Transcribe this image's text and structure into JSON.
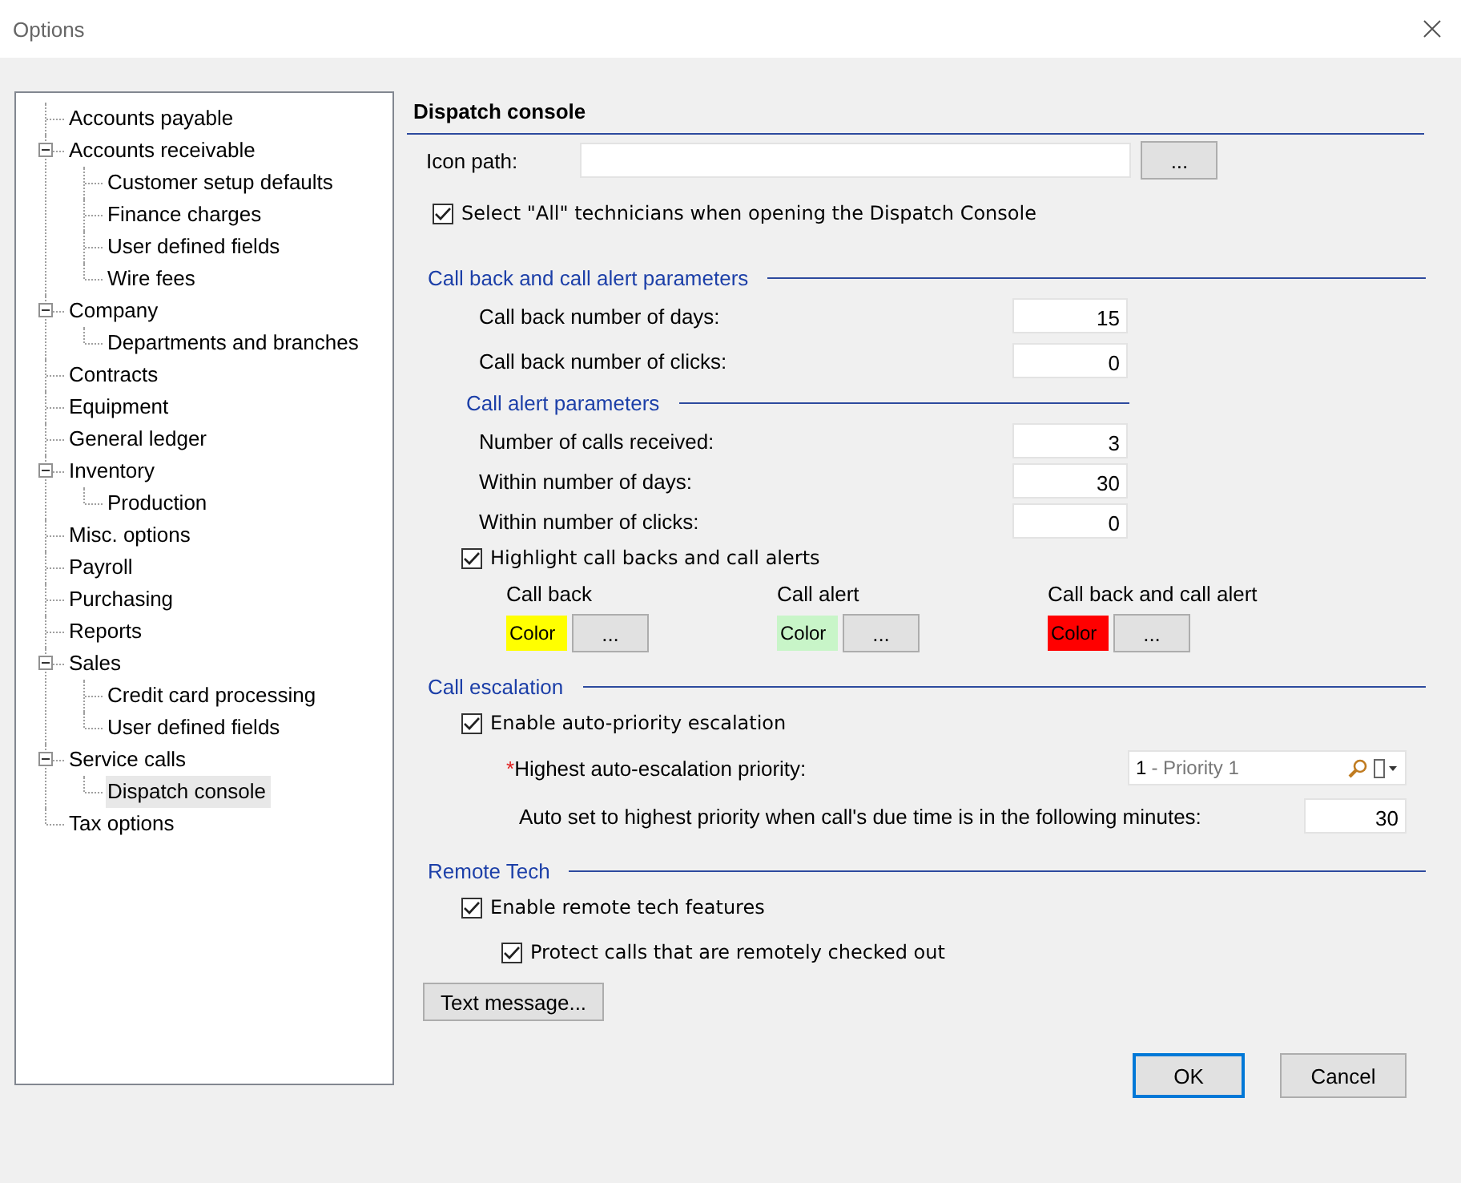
{
  "window": {
    "title": "Options"
  },
  "tree": [
    {
      "label": "Accounts payable",
      "selected": false
    },
    {
      "label": "Accounts receivable",
      "selected": false,
      "expanded": true,
      "children": [
        {
          "label": "Customer setup defaults",
          "selected": false
        },
        {
          "label": "Finance charges",
          "selected": false
        },
        {
          "label": "User defined fields",
          "selected": false
        },
        {
          "label": "Wire fees",
          "selected": false
        }
      ]
    },
    {
      "label": "Company",
      "selected": false,
      "expanded": true,
      "children": [
        {
          "label": "Departments and branches",
          "selected": false
        }
      ]
    },
    {
      "label": "Contracts",
      "selected": false
    },
    {
      "label": "Equipment",
      "selected": false
    },
    {
      "label": "General ledger",
      "selected": false
    },
    {
      "label": "Inventory",
      "selected": false,
      "expanded": true,
      "children": [
        {
          "label": "Production",
          "selected": false
        }
      ]
    },
    {
      "label": "Misc. options",
      "selected": false
    },
    {
      "label": "Payroll",
      "selected": false
    },
    {
      "label": "Purchasing",
      "selected": false
    },
    {
      "label": "Reports",
      "selected": false
    },
    {
      "label": "Sales",
      "selected": false,
      "expanded": true,
      "children": [
        {
          "label": "Credit card processing",
          "selected": false
        },
        {
          "label": "User defined fields",
          "selected": false
        }
      ]
    },
    {
      "label": "Service calls",
      "selected": false,
      "expanded": true,
      "children": [
        {
          "label": "Dispatch console",
          "selected": true
        }
      ]
    },
    {
      "label": "Tax options",
      "selected": false
    }
  ],
  "panel": {
    "title": "Dispatch console",
    "icon_path": {
      "label": "Icon path:",
      "button": "..."
    },
    "select_all": {
      "label": "Select \"All\" technicians when opening the Dispatch Console",
      "checked": true
    },
    "callback": {
      "title": "Call back and call alert parameters",
      "fields": [
        {
          "label": "Call back number of days:",
          "value": "15"
        },
        {
          "label": "Call back number of clicks:",
          "value": "0"
        }
      ],
      "alert": {
        "title": "Call alert parameters",
        "fields": [
          {
            "label": "Number of calls received:",
            "value": "3"
          },
          {
            "label": "Within number of days:",
            "value": "30"
          },
          {
            "label": "Within number of clicks:",
            "value": "0"
          }
        ]
      },
      "highlight": {
        "label": "Highlight call backs and call alerts",
        "checked": true
      },
      "colors": [
        {
          "label": "Call back",
          "swatch": "Color",
          "color": "#ffff00",
          "button": "..."
        },
        {
          "label": "Call alert",
          "swatch": "Color",
          "color": "#c8f5c8",
          "button": "..."
        },
        {
          "label": "Call back and call alert",
          "swatch": "Color",
          "color": "#ff0000",
          "button": "..."
        }
      ]
    },
    "escalation": {
      "title": "Call escalation",
      "enable": {
        "label": "Enable auto-priority escalation",
        "checked": true
      },
      "priority": {
        "required_mark": "*",
        "label": "Highest auto-escalation priority:",
        "code": "1",
        "name": "- Priority 1"
      },
      "auto_set": {
        "label": "Auto set to highest priority when call's due time is in the following minutes:",
        "value": "30"
      }
    },
    "remote": {
      "title": "Remote Tech",
      "enable": {
        "label": "Enable remote tech features",
        "checked": true
      },
      "protect": {
        "label": "Protect calls that are remotely checked out",
        "checked": true
      }
    },
    "text_message_button": "Text message..."
  },
  "buttons": [
    {
      "label": "OK",
      "default": true
    },
    {
      "label": "Cancel",
      "default": false
    }
  ]
}
